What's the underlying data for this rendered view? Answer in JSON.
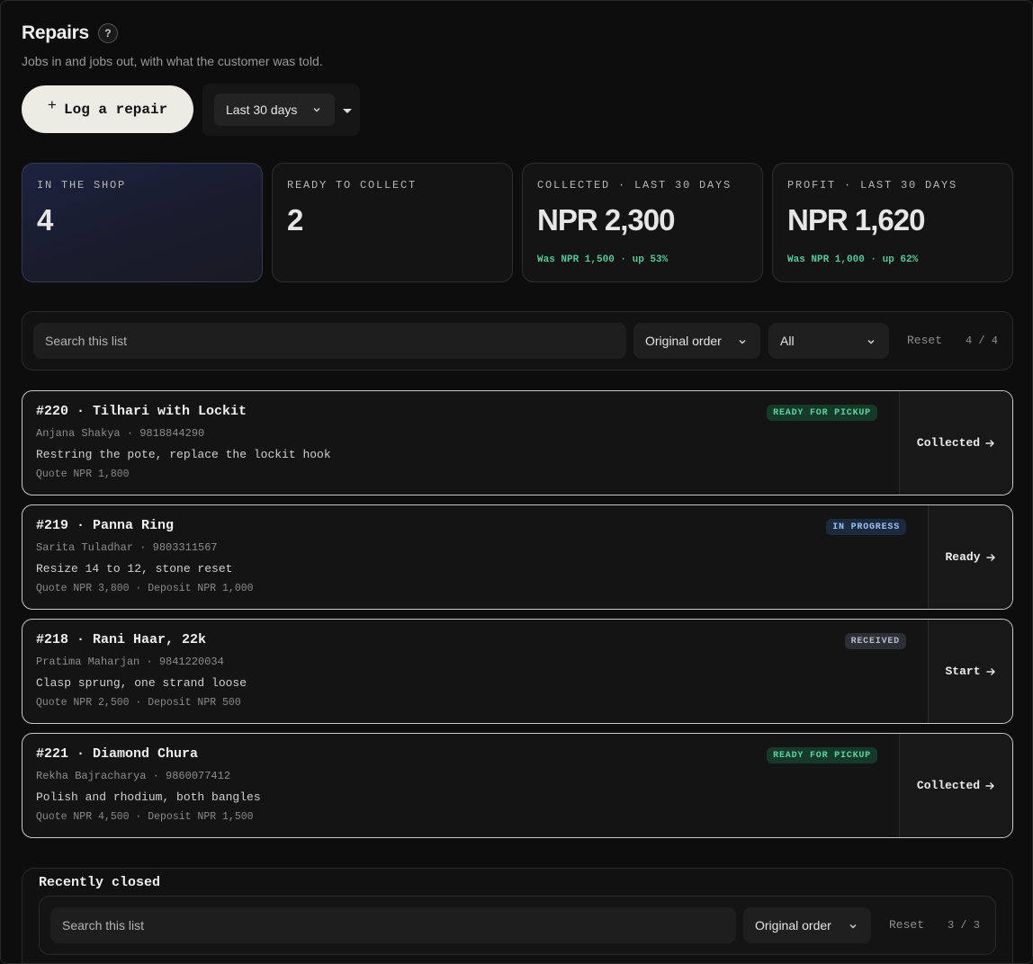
{
  "header": {
    "title": "Repairs",
    "help_glyph": "?",
    "subtitle": "Jobs in and jobs out, with what the customer was told."
  },
  "toolbar": {
    "log_plus": "+",
    "log_label": "Log a repair",
    "range_value": "Last 30 days"
  },
  "stats": [
    {
      "label": "IN THE SHOP",
      "value": "4",
      "delta": ""
    },
    {
      "label": "READY TO COLLECT",
      "value": "2",
      "delta": ""
    },
    {
      "label": "COLLECTED · LAST 30 DAYS",
      "value": "NPR 2,300",
      "delta": "Was NPR 1,500 · up 53%"
    },
    {
      "label": "PROFIT · LAST 30 DAYS",
      "value": "NPR 1,620",
      "delta": "Was NPR 1,000 · up 62%"
    }
  ],
  "filter": {
    "search_placeholder": "Search this list",
    "order_value": "Original order",
    "status_value": "All",
    "reset_label": "Reset",
    "count": "4 / 4"
  },
  "repairs": [
    {
      "head": "#220  · Tilhari with Lockit",
      "customer": "Anjana Shakya  · 9818844290",
      "desc": "Restring the pote, replace the lockit hook",
      "quote": "Quote NPR 1,800",
      "badge": "READY FOR PICKUP",
      "action": "Collected"
    },
    {
      "head": "#219  · Panna Ring",
      "customer": "Sarita Tuladhar  · 9803311567",
      "desc": "Resize 14 to 12, stone reset",
      "quote": "Quote NPR 3,800  · Deposit NPR 1,000",
      "badge": "IN PROGRESS",
      "action": "Ready"
    },
    {
      "head": "#218  · Rani Haar, 22k",
      "customer": "Pratima Maharjan  · 9841220034",
      "desc": "Clasp sprung, one strand loose",
      "quote": "Quote NPR 2,500  · Deposit NPR 500",
      "badge": "RECEIVED",
      "action": "Start"
    },
    {
      "head": "#221  · Diamond Chura",
      "customer": "Rekha Bajracharya  · 9860077412",
      "desc": "Polish and rhodium, both bangles",
      "quote": "Quote NPR 4,500  · Deposit NPR 1,500",
      "badge": "READY FOR PICKUP",
      "action": "Collected"
    }
  ],
  "closed": {
    "title": "Recently closed",
    "search_placeholder": "Search this list",
    "order_value": "Original order",
    "reset_label": "Reset",
    "count": "3 / 3"
  },
  "colors": {
    "accent_green": "#58c79a",
    "badge_ready_bg": "#163a2a",
    "badge_progress_bg": "#1c2a40",
    "badge_received_bg": "#2c2f36",
    "primary_button_bg": "#ecebe4"
  }
}
